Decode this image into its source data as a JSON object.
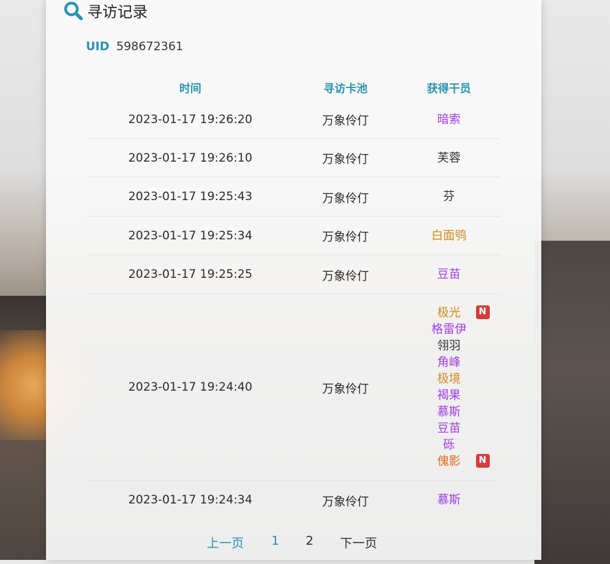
{
  "header": {
    "title": "寻访记录",
    "icon": "search-icon"
  },
  "uid": {
    "label": "UID",
    "value": "598672361"
  },
  "table": {
    "headers": [
      "时间",
      "寻访卡池",
      "获得干员"
    ],
    "rows": [
      {
        "time": "2023-01-17 19:26:20",
        "pool": "万象伶仃",
        "ops": [
          {
            "name": "暗索",
            "color": "#a13ee0",
            "new": false
          }
        ]
      },
      {
        "time": "2023-01-17 19:26:10",
        "pool": "万象伶仃",
        "ops": [
          {
            "name": "芙蓉",
            "color": "#333333",
            "new": false
          }
        ]
      },
      {
        "time": "2023-01-17 19:25:43",
        "pool": "万象伶仃",
        "ops": [
          {
            "name": "芬",
            "color": "#333333",
            "new": false
          }
        ]
      },
      {
        "time": "2023-01-17 19:25:34",
        "pool": "万象伶仃",
        "ops": [
          {
            "name": "白面鸮",
            "color": "#d08a1f",
            "new": false
          }
        ]
      },
      {
        "time": "2023-01-17 19:25:25",
        "pool": "万象伶仃",
        "ops": [
          {
            "name": "豆苗",
            "color": "#a13ee0",
            "new": false
          }
        ]
      },
      {
        "time": "2023-01-17 19:24:40",
        "pool": "万象伶仃",
        "ops": [
          {
            "name": "极光",
            "color": "#d08a1f",
            "new": true,
            "badge": "N"
          },
          {
            "name": "格雷伊",
            "color": "#a13ee0",
            "new": false
          },
          {
            "name": "翎羽",
            "color": "#333333",
            "new": false
          },
          {
            "name": "角峰",
            "color": "#a13ee0",
            "new": false
          },
          {
            "name": "极境",
            "color": "#d08a1f",
            "new": false
          },
          {
            "name": "褐果",
            "color": "#a13ee0",
            "new": false
          },
          {
            "name": "慕斯",
            "color": "#a13ee0",
            "new": false
          },
          {
            "name": "豆苗",
            "color": "#a13ee0",
            "new": false
          },
          {
            "name": "砾",
            "color": "#a13ee0",
            "new": false
          },
          {
            "name": "傀影",
            "color": "#e06a1a",
            "new": true,
            "badge": "N"
          }
        ]
      },
      {
        "time": "2023-01-17 19:24:34",
        "pool": "万象伶仃",
        "ops": [
          {
            "name": "慕斯",
            "color": "#a13ee0",
            "new": false
          }
        ]
      }
    ]
  },
  "pager": {
    "prev": "上一页",
    "page1": "1",
    "page2": "2",
    "next": "下一页"
  },
  "colors": {
    "accent": "#2a93b0",
    "badge": "#d63b3b"
  }
}
